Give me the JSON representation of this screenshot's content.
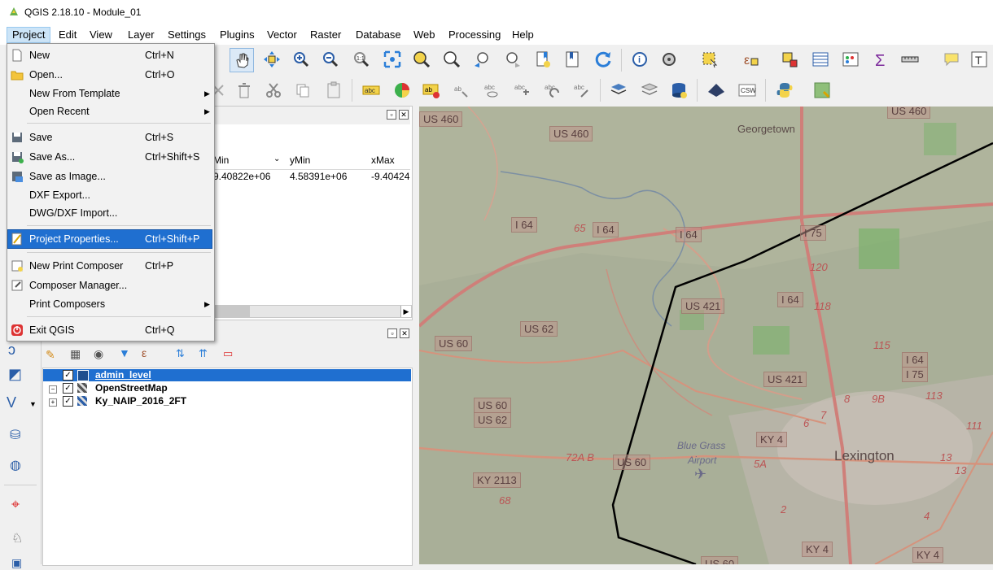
{
  "window": {
    "title": "QGIS 2.18.10 - Module_01"
  },
  "menubar": [
    "Project",
    "Edit",
    "View",
    "Layer",
    "Settings",
    "Plugins",
    "Vector",
    "Raster",
    "Database",
    "Web",
    "Processing",
    "Help"
  ],
  "project_menu": {
    "items": [
      {
        "label": "New",
        "shortcut": "Ctrl+N",
        "icon": "new-file-icon"
      },
      {
        "label": "Open...",
        "shortcut": "Ctrl+O",
        "icon": "open-folder-icon"
      },
      {
        "label": "New From Template",
        "shortcut": "",
        "icon": "",
        "submenu": true
      },
      {
        "label": "Open Recent",
        "shortcut": "",
        "icon": "",
        "submenu": true
      },
      {
        "label": "Save",
        "shortcut": "Ctrl+S",
        "icon": "save-icon"
      },
      {
        "label": "Save As...",
        "shortcut": "Ctrl+Shift+S",
        "icon": "save-as-icon"
      },
      {
        "label": "Save as Image...",
        "shortcut": "",
        "icon": "save-image-icon"
      },
      {
        "label": "DXF Export...",
        "shortcut": "",
        "icon": ""
      },
      {
        "label": "DWG/DXF Import...",
        "shortcut": "",
        "icon": ""
      },
      {
        "label": "Project Properties...",
        "shortcut": "Ctrl+Shift+P",
        "icon": "project-properties-icon",
        "highlighted": true
      },
      {
        "label": "New Print Composer",
        "shortcut": "Ctrl+P",
        "icon": "new-composer-icon"
      },
      {
        "label": "Composer Manager...",
        "shortcut": "",
        "icon": "composer-manager-icon"
      },
      {
        "label": "Print Composers",
        "shortcut": "",
        "icon": "",
        "submenu": true
      },
      {
        "label": "Exit QGIS",
        "shortcut": "Ctrl+Q",
        "icon": "exit-icon"
      }
    ]
  },
  "table": {
    "headers": [
      "Min",
      "yMin",
      "xMax"
    ],
    "row": [
      "9.40822e+06",
      "4.58391e+06",
      "-9.40424"
    ]
  },
  "layers": [
    {
      "name": "admin_level",
      "checked": true,
      "selected": true
    },
    {
      "name": "OpenStreetMap",
      "checked": true,
      "selected": false
    },
    {
      "name": "Ky_NAIP_2016_2FT",
      "checked": true,
      "selected": false
    }
  ],
  "map_labels": {
    "towns": [
      "Georgetown",
      "Lexington",
      "Blue Grass",
      "Airport"
    ],
    "shields": [
      "US 460",
      "US 460",
      "I 64",
      "I 64",
      "I 64",
      "I 75",
      "US 421",
      "US 62",
      "US 60",
      "I 64",
      "US 421",
      "I 64",
      "I 75",
      "US 60",
      "US 62",
      "KY 4",
      "US 60",
      "KY 2113",
      "KY 4",
      "KY 4",
      "US 460",
      "US 60"
    ],
    "route_numbers": [
      "65",
      "120",
      "118",
      "115",
      "113",
      "8",
      "9B",
      "111",
      "13",
      "6",
      "7",
      "72A B",
      "5A",
      "68",
      "2",
      "4",
      "13"
    ]
  },
  "colors": {
    "highlight": "#1f6fd0",
    "map_bg": "#a7ae95",
    "boundary": "#000000"
  }
}
